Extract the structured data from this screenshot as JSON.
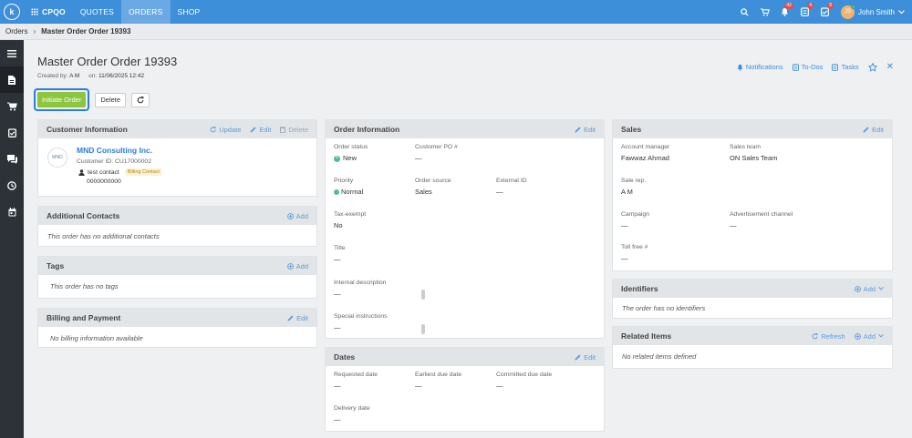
{
  "nav": {
    "brand": "CPQO",
    "items": [
      "QUOTES",
      "ORDERS",
      "SHOP"
    ],
    "badges": {
      "notifications": "42",
      "todos": "4",
      "tasks": "8"
    },
    "avatar_initials": "JS",
    "user_name": "John Smith"
  },
  "breadcrumb": {
    "root": "Orders",
    "current": "Master Order Order 19393"
  },
  "header": {
    "title": "Master Order Order 19393",
    "created_by_label": "Created by:",
    "created_by": "A M",
    "on_label": "on:",
    "created_on": "11/06/2025 12:42",
    "initiate_label": "Initiate Order",
    "delete_label": "Delete",
    "links": {
      "notifications": "Notifications",
      "todos": "To-Dos",
      "tasks": "Tasks"
    }
  },
  "customer": {
    "title": "Customer Information",
    "update": "Update",
    "edit": "Edit",
    "delete": "Delete",
    "logo_text": "MND",
    "name": "MND Consulting Inc.",
    "id_label": "Customer ID:",
    "id": "CU17000002",
    "contact": "test contact",
    "contact_tag": "Billing Contact",
    "phone": "0000000000"
  },
  "additional_contacts": {
    "title": "Additional Contacts",
    "add": "Add",
    "empty": "This order has no additional contacts"
  },
  "tags": {
    "title": "Tags",
    "add": "Add",
    "empty": "This order has no tags"
  },
  "billing": {
    "title": "Billing and Payment",
    "edit": "Edit",
    "empty": "No billing information available"
  },
  "order_info": {
    "title": "Order Information",
    "edit": "Edit",
    "status_label": "Order status",
    "status": "New",
    "po_label": "Customer PO #",
    "po": "—",
    "priority_label": "Priority",
    "priority": "Normal",
    "source_label": "Order source",
    "source": "Sales",
    "external_label": "External ID",
    "external": "—",
    "tax_label": "Tax-exempt",
    "tax": "No",
    "title_label": "Title",
    "title_val": "—",
    "internal_label": "Internal description",
    "internal": "—",
    "special_label": "Special instructions",
    "special": "—"
  },
  "dates": {
    "title": "Dates",
    "edit": "Edit",
    "requested_label": "Requested date",
    "requested": "—",
    "earliest_label": "Earliest due date",
    "earliest": "—",
    "committed_label": "Committed due date",
    "committed": "—",
    "delivery_label": "Delivery date",
    "delivery": "—"
  },
  "sales": {
    "title": "Sales",
    "edit": "Edit",
    "manager_label": "Account manager",
    "manager": "Fawwaz Ahmad",
    "team_label": "Sales team",
    "team": "ON Sales Team",
    "rep_label": "Sale rep.",
    "rep": "A M",
    "campaign_label": "Campaign",
    "campaign": "—",
    "adv_label": "Advertisement channel",
    "adv": "—",
    "toll_label": "Toll free #",
    "toll": "—"
  },
  "identifiers": {
    "title": "Identifiers",
    "add": "Add",
    "empty": "The order has no identifiers"
  },
  "related": {
    "title": "Related Items",
    "refresh": "Refresh",
    "add": "Add",
    "empty": "No related items defined"
  },
  "colors": {
    "nav": "#3d8fd9",
    "sidebar": "#2d3238",
    "primary": "#8cc63f",
    "link": "#2a7de1"
  }
}
